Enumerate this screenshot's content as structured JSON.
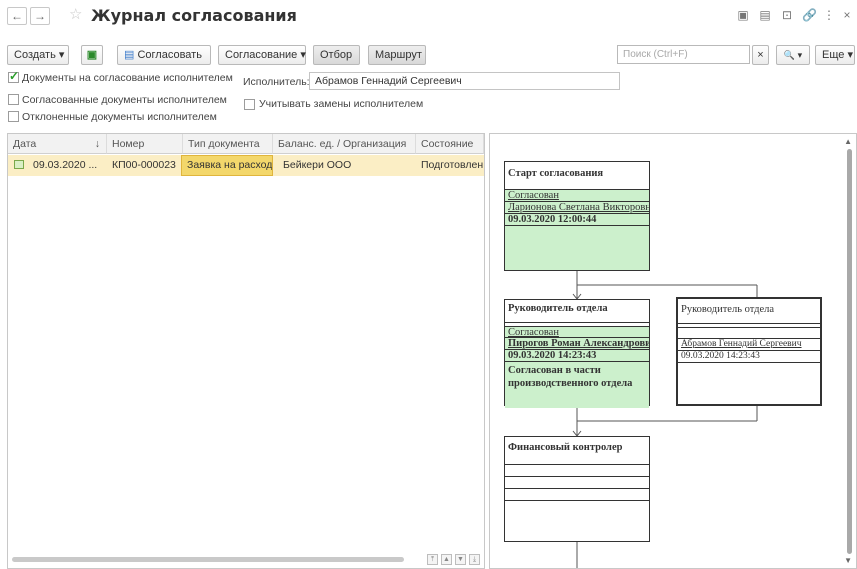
{
  "window": {
    "title": "Журнал согласования",
    "back_icon": "←",
    "forward_icon": "→",
    "star_icon": "☆",
    "top_icons": [
      "▣",
      "▤",
      "⊡",
      "🔗",
      "⋮",
      "×"
    ]
  },
  "toolbar": {
    "create_label": "Создать ▾",
    "approve_label": "Согласовать",
    "approval_menu_label": "Согласование ▾",
    "filter_label": "Отбор",
    "route_label": "Маршрут",
    "search_placeholder": "Поиск (Ctrl+F)",
    "search_clear": "×",
    "search_find": "🔍 ▾",
    "more_label": "Еще ▾"
  },
  "filters": {
    "docs_for_approval": "Документы на согласование исполнителем",
    "docs_approved": "Согласованные документы исполнителем",
    "docs_rejected": "Отклоненные документы исполнителем",
    "performer_label": "Исполнитель:",
    "performer_value": "Абрамов Геннадий Сергеевич",
    "consider_replacements": "Учитывать замены исполнителем"
  },
  "table": {
    "columns": [
      "Дата",
      "Номер",
      "Тип документа",
      "Баланс. ед. / Организация",
      "Состояние"
    ],
    "sort_icon": "↓",
    "rows": [
      {
        "date": "09.03.2020 ...",
        "number": "КП00-000023",
        "doc_type": "Заявка на расход",
        "org": "Бейкери ООО",
        "state": "Подготовлен"
      }
    ]
  },
  "diagram": {
    "start": {
      "title": "Старт согласования",
      "status": "Согласован",
      "person": "Ларионова Светлана Викторовна",
      "datetime": "09.03.2020 12:00:44"
    },
    "head1": {
      "title": "Руководитель отдела",
      "status": "Согласован",
      "person": "Пирогов Роман Александрович",
      "datetime": "09.03.2020 14:23:43",
      "note": "Согласован в части производственного отдела"
    },
    "head2": {
      "title": "Руководитель отдела",
      "status": "",
      "person": "Абрамов Геннадий Сергеевич",
      "datetime": "09.03.2020 14:23:43"
    },
    "finance": {
      "title": "Финансовый контролер"
    }
  },
  "colors": {
    "approved_green": "#ccf0cc",
    "selected_row": "#fbeec5",
    "highlight_cell": "#f3d76b"
  }
}
